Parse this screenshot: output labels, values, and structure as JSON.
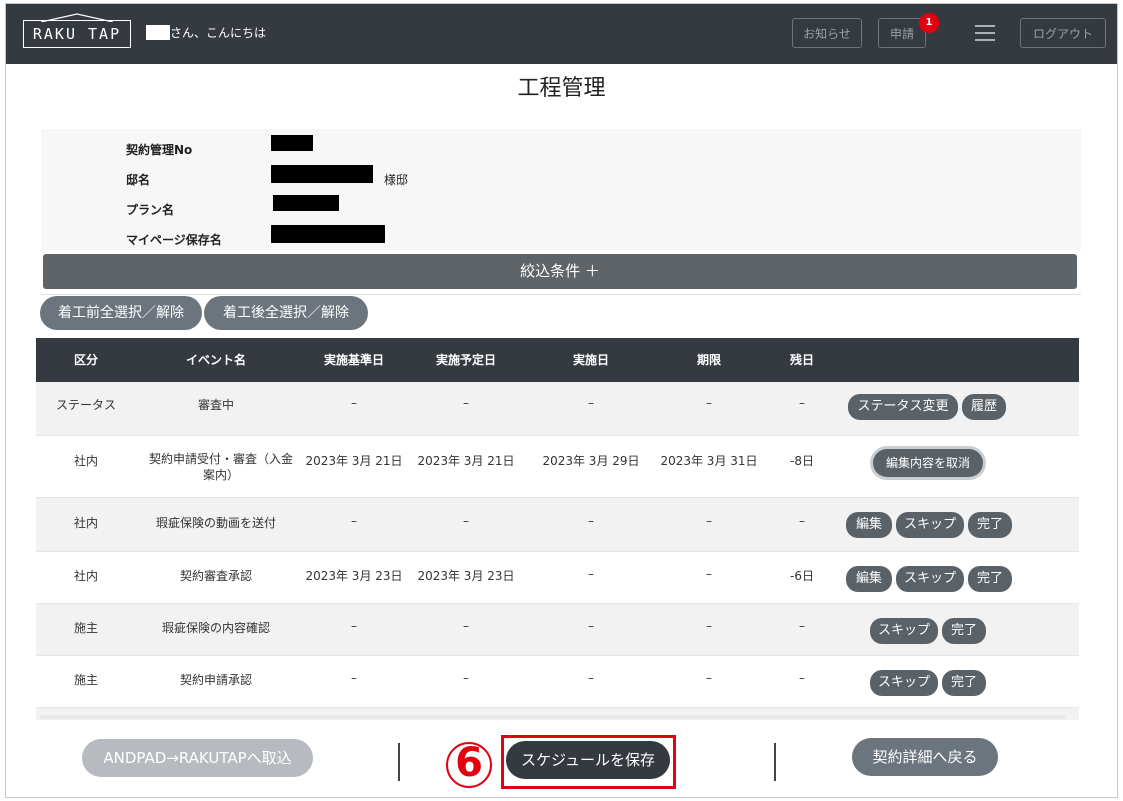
{
  "header": {
    "logo_text": "RAKU TAP",
    "greeting": "さん、こんにちは",
    "notice_label": "お知らせ",
    "apply_label": "申請",
    "apply_badge": "1",
    "logout_label": "ログアウト"
  },
  "page_title": "工程管理",
  "info": {
    "contract_no_label": "契約管理No",
    "house_label": "邸名",
    "house_suffix": "様邸",
    "plan_label": "プラン名",
    "mypage_label": "マイページ保存名"
  },
  "filter_label": "絞込条件 ＋",
  "select_before_label": "着工前全選択／解除",
  "select_after_label": "着工後全選択／解除",
  "table": {
    "headers": [
      "区分",
      "イベント名",
      "実施基準日",
      "実施予定日",
      "実施日",
      "期限",
      "残日"
    ],
    "rows": [
      {
        "category": "ステータス",
        "event": "審査中",
        "base": "–",
        "planned": "–",
        "done": "–",
        "deadline": "–",
        "remaining": "–"
      },
      {
        "category": "社内",
        "event": "契約申請受付・審査（入金案内）",
        "base": "2023年 3月 21日",
        "planned": "2023年 3月 21日",
        "done": "2023年 3月 29日",
        "deadline": "2023年 3月 31日",
        "remaining": "-8日"
      },
      {
        "category": "社内",
        "event": "瑕疵保険の動画を送付",
        "base": "–",
        "planned": "–",
        "done": "–",
        "deadline": "–",
        "remaining": "–"
      },
      {
        "category": "社内",
        "event": "契約審査承認",
        "base": "2023年 3月 23日",
        "planned": "2023年 3月 23日",
        "done": "–",
        "deadline": "–",
        "remaining": "-6日"
      },
      {
        "category": "施主",
        "event": "瑕疵保険の内容確認",
        "base": "–",
        "planned": "–",
        "done": "–",
        "deadline": "–",
        "remaining": "–"
      },
      {
        "category": "施主",
        "event": "契約申請承認",
        "base": "–",
        "planned": "–",
        "done": "–",
        "deadline": "–",
        "remaining": "–"
      }
    ],
    "actions": {
      "status_change": "ステータス変更",
      "history": "履歴",
      "cancel_edit": "編集内容を取消",
      "edit": "編集",
      "skip": "スキップ",
      "complete": "完了"
    }
  },
  "footer": {
    "import_label": "ANDPAD→RAKUTAPへ取込",
    "step_number": "6",
    "save_label": "スケジュールを保存",
    "back_label": "契約詳細へ戻る"
  },
  "colors": {
    "header_bg": "#343a40",
    "button_gray": "#5a6268",
    "highlight_red": "#e3000f"
  }
}
